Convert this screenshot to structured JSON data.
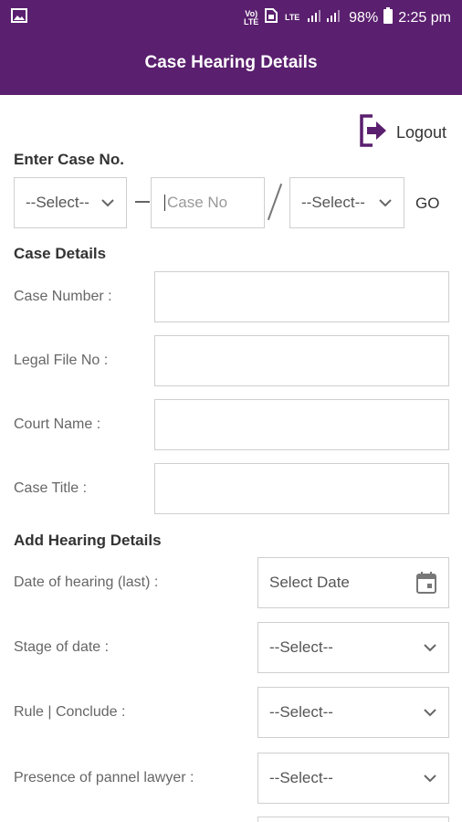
{
  "status": {
    "volte": "Vo) LTE",
    "lte": "LTE",
    "battery": "98%",
    "time": "2:25 pm"
  },
  "appbar": {
    "title": "Case Hearing Details"
  },
  "logout": {
    "label": "Logout"
  },
  "enter_case": {
    "heading": "Enter Case No.",
    "select1": "--Select--",
    "case_no_placeholder": "Case No",
    "select2": "--Select--",
    "go": "GO"
  },
  "case_details": {
    "heading": "Case Details",
    "fields": [
      {
        "label": "Case Number :",
        "value": ""
      },
      {
        "label": "Legal File No :",
        "value": ""
      },
      {
        "label": "Court Name :",
        "value": ""
      },
      {
        "label": "Case Title :",
        "value": ""
      }
    ]
  },
  "hearing": {
    "heading": "Add Hearing Details",
    "date_label": "Date of hearing (last) :",
    "date_placeholder": "Select Date",
    "stage_label": "Stage of date :",
    "stage_value": "--Select--",
    "rule_label": "Rule | Conclude :",
    "rule_value": "--Select--",
    "presence_label": "Presence of pannel lawyer :",
    "presence_value": "--Select--"
  }
}
